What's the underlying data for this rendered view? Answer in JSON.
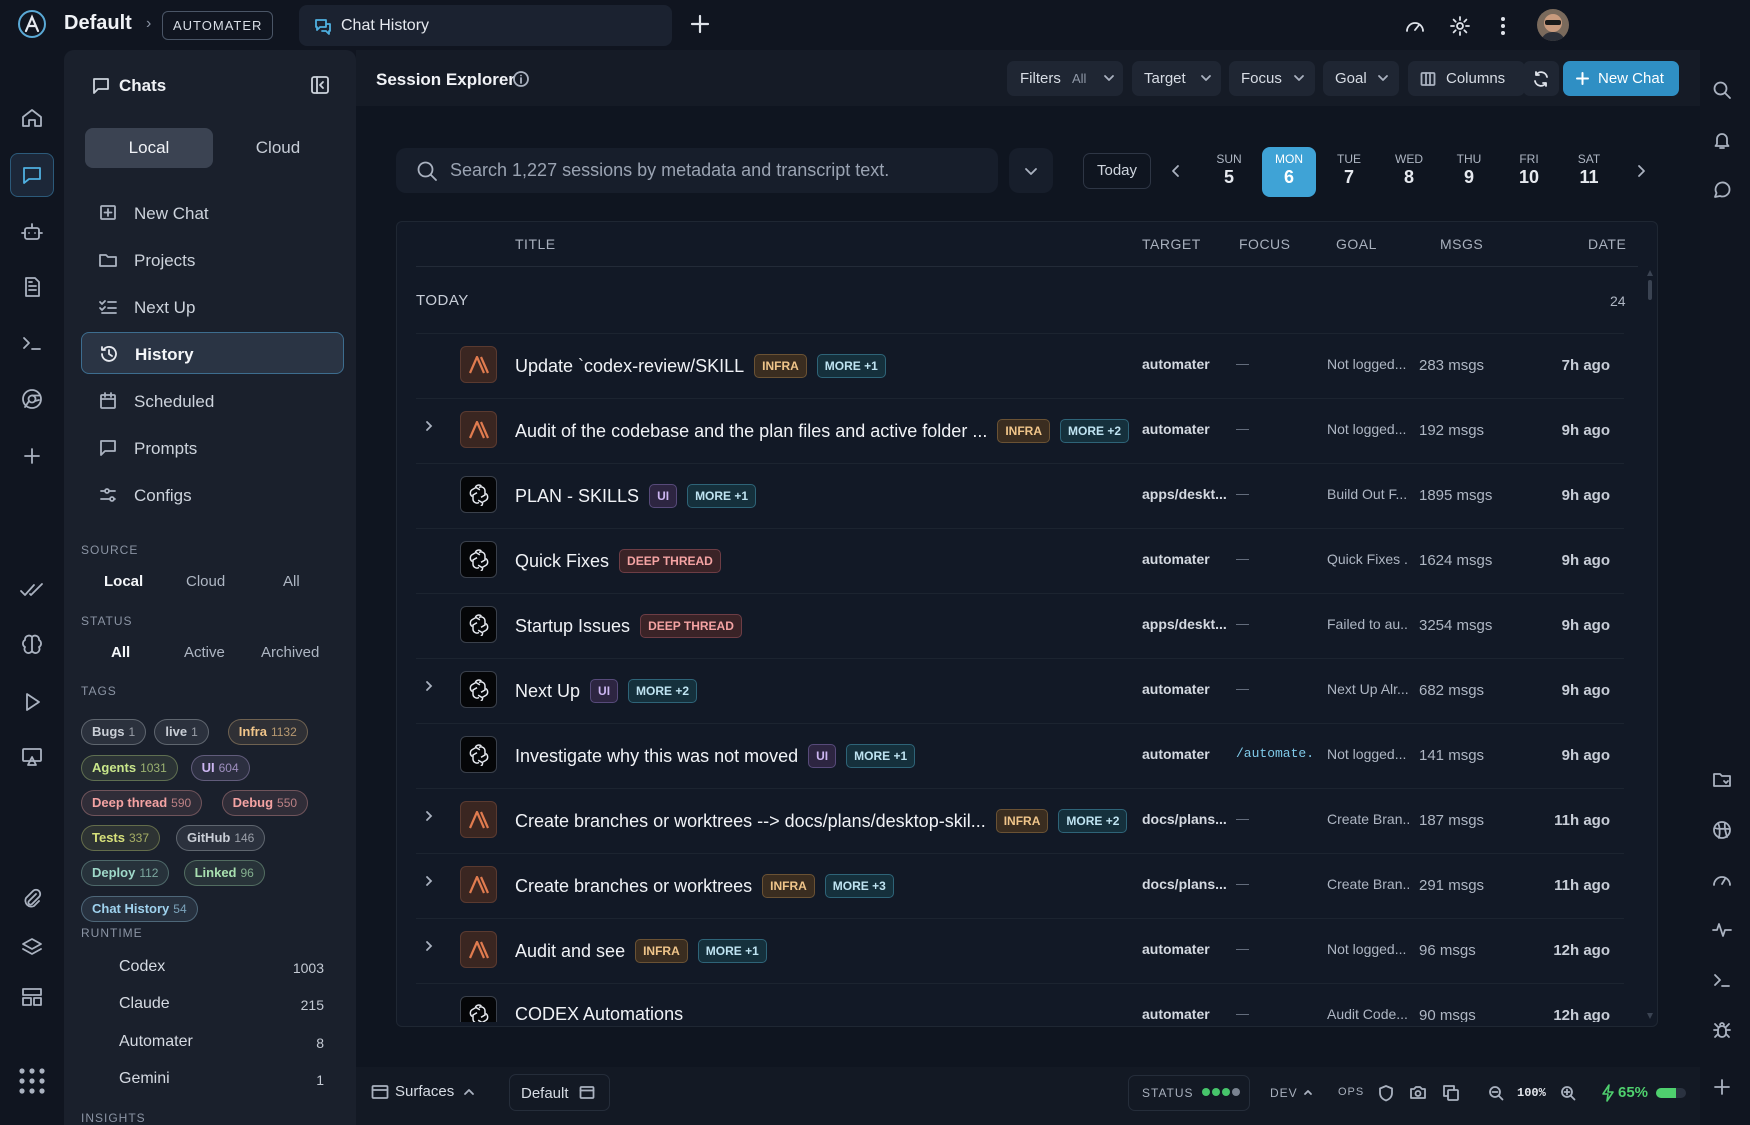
{
  "app": {
    "workspace": "Default",
    "workspace_badge": "AUTOMATER",
    "active_tab": "Chat History"
  },
  "chats_panel": {
    "title": "Chats",
    "segments": [
      "Local",
      "Cloud"
    ],
    "nav": [
      {
        "label": "New Chat",
        "icon": "plus-square-icon"
      },
      {
        "label": "Projects",
        "icon": "folder-icon"
      },
      {
        "label": "Next Up",
        "icon": "checklist-icon"
      },
      {
        "label": "History",
        "icon": "history-icon",
        "active": true
      },
      {
        "label": "Scheduled",
        "icon": "calendar-icon"
      },
      {
        "label": "Prompts",
        "icon": "message-square-icon"
      },
      {
        "label": "Configs",
        "icon": "sliders-icon"
      }
    ],
    "source": {
      "label": "SOURCE",
      "options": [
        "Local",
        "Cloud",
        "All"
      ],
      "selected": "Local"
    },
    "status": {
      "label": "STATUS",
      "options": [
        "All",
        "Active",
        "Archived"
      ],
      "selected": "All"
    },
    "tags_label": "TAGS",
    "tags": [
      {
        "name": "Bugs",
        "count": "1",
        "color": "#c9ced6"
      },
      {
        "name": "live",
        "count": "1",
        "color": "#c9ced6"
      },
      {
        "name": "Infra",
        "count": "1132",
        "color": "#f0c58a"
      },
      {
        "name": "Agents",
        "count": "1031",
        "color": "#c8e68a"
      },
      {
        "name": "UI",
        "count": "604",
        "color": "#cdb6f2"
      },
      {
        "name": "Deep thread",
        "count": "590",
        "color": "#f4a3a3"
      },
      {
        "name": "Debug",
        "count": "550",
        "color": "#f4a3a3"
      },
      {
        "name": "Tests",
        "count": "337",
        "color": "#d6e07a"
      },
      {
        "name": "GitHub",
        "count": "146",
        "color": "#c9ced6"
      },
      {
        "name": "Deploy",
        "count": "112",
        "color": "#9fd9c9"
      },
      {
        "name": "Linked",
        "count": "96",
        "color": "#a8e0b0"
      },
      {
        "name": "Chat History",
        "count": "54",
        "color": "#9fd2ee"
      }
    ],
    "runtime_label": "RUNTIME",
    "runtime": [
      {
        "name": "Codex",
        "count": "1003"
      },
      {
        "name": "Claude",
        "count": "215"
      },
      {
        "name": "Automater",
        "count": "8"
      },
      {
        "name": "Gemini",
        "count": "1"
      }
    ],
    "insights_label": "INSIGHTS"
  },
  "header": {
    "title": "Session Explorer",
    "filters_label": "Filters",
    "filters_value": "All",
    "target_label": "Target",
    "focus_label": "Focus",
    "goal_label": "Goal",
    "columns_label": "Columns",
    "new_chat_label": "New Chat"
  },
  "search": {
    "placeholder": "Search 1,227 sessions by metadata and transcript text."
  },
  "calendar": {
    "today_label": "Today",
    "days": [
      {
        "name": "SUN",
        "num": "5"
      },
      {
        "name": "MON",
        "num": "6",
        "selected": true
      },
      {
        "name": "TUE",
        "num": "7"
      },
      {
        "name": "WED",
        "num": "8"
      },
      {
        "name": "THU",
        "num": "9"
      },
      {
        "name": "FRI",
        "num": "10"
      },
      {
        "name": "SAT",
        "num": "11"
      }
    ]
  },
  "table": {
    "columns": {
      "title": "TITLE",
      "target": "TARGET",
      "focus": "FOCUS",
      "goal": "GOAL",
      "msgs": "MSGS",
      "date": "DATE"
    },
    "group": {
      "label": "TODAY",
      "count": "24"
    },
    "rows": [
      {
        "avatar": "claude",
        "expand": false,
        "title": "Update `codex-review/SKILL",
        "badge": "INFRA",
        "more": "MORE +1",
        "target": "automater",
        "focus": "—",
        "goal": "Not logged...",
        "msgs": "283 msgs",
        "date": "7h ago"
      },
      {
        "avatar": "claude",
        "expand": true,
        "title": "Audit of the codebase and the plan files and active folder ...",
        "badge": "INFRA",
        "more": "MORE +2",
        "target": "automater",
        "focus": "—",
        "goal": "Not logged...",
        "msgs": "192 msgs",
        "date": "9h ago"
      },
      {
        "avatar": "gpt",
        "expand": false,
        "title": "PLAN - SKILLS",
        "badge": "UI",
        "more": "MORE +1",
        "target": "apps/deskt...",
        "focus": "—",
        "goal": "Build Out F...",
        "msgs": "1895 msgs",
        "date": "9h ago"
      },
      {
        "avatar": "gpt",
        "expand": false,
        "title": "Quick Fixes",
        "badge": "DEEP THREAD",
        "more": "",
        "target": "automater",
        "focus": "—",
        "goal": "Quick Fixes ...",
        "msgs": "1624 msgs",
        "date": "9h ago"
      },
      {
        "avatar": "gpt",
        "expand": false,
        "title": "Startup Issues",
        "badge": "DEEP THREAD",
        "more": "",
        "target": "apps/deskt...",
        "focus": "—",
        "goal": "Failed to au...",
        "msgs": "3254 msgs",
        "date": "9h ago"
      },
      {
        "avatar": "gpt",
        "expand": true,
        "title": "Next Up",
        "badge": "UI",
        "more": "MORE +2",
        "target": "automater",
        "focus": "—",
        "goal": "Next Up Alr...",
        "msgs": "682 msgs",
        "date": "9h ago"
      },
      {
        "avatar": "gpt",
        "expand": false,
        "title": "Investigate why this was not moved",
        "badge": "UI",
        "more": "MORE +1",
        "target": "automater",
        "focus": "/automate...",
        "goal": "Not logged...",
        "msgs": "141 msgs",
        "date": "9h ago"
      },
      {
        "avatar": "claude",
        "expand": true,
        "title": "Create branches or worktrees --> docs/plans/desktop-skil...",
        "badge": "INFRA",
        "more": "MORE +2",
        "target": "docs/plans...",
        "focus": "—",
        "goal": "Create Bran...",
        "msgs": "187 msgs",
        "date": "11h ago"
      },
      {
        "avatar": "claude",
        "expand": true,
        "title": "Create branches or worktrees",
        "badge": "INFRA",
        "more": "MORE +3",
        "target": "docs/plans...",
        "focus": "—",
        "goal": "Create Bran...",
        "msgs": "291 msgs",
        "date": "11h ago"
      },
      {
        "avatar": "claude",
        "expand": true,
        "title": "Audit and see",
        "badge": "INFRA",
        "more": "MORE +1",
        "target": "automater",
        "focus": "—",
        "goal": "Not logged...",
        "msgs": "96 msgs",
        "date": "12h ago"
      },
      {
        "avatar": "gpt",
        "expand": false,
        "title": "CODEX Automations",
        "badge": "",
        "more": "",
        "target": "automater",
        "focus": "—",
        "goal": "Audit Code...",
        "msgs": "90 msgs",
        "date": "12h ago"
      }
    ]
  },
  "footer": {
    "surfaces_label": "Surfaces",
    "default_label": "Default",
    "status_label": "STATUS",
    "env_label": "DEV",
    "ops_label": "OPS",
    "zoom": "100%",
    "battery": "65%",
    "battery_level": 0.65
  },
  "colors": {
    "accent": "#3fa3d6",
    "new_chat": "#2f8fc4"
  }
}
